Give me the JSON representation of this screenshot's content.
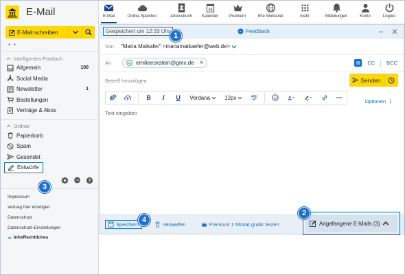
{
  "brand": {
    "logo_text": "WEB.DE",
    "app_title": "E-Mail"
  },
  "sidebar": {
    "compose_label": "E-Mail schreiben",
    "more_dots": "• •",
    "smart_inbox_heading": "Intelligentes Postfach",
    "smart_items": [
      {
        "label": "Allgemein",
        "count": "100",
        "icon": "inbox-icon"
      },
      {
        "label": "Social Media",
        "count": "",
        "icon": "social-icon"
      },
      {
        "label": "Newsletter",
        "count": "1",
        "icon": "newsletter-icon"
      },
      {
        "label": "Bestellungen",
        "count": "",
        "icon": "cart-icon"
      },
      {
        "label": "Verträge & Abos",
        "count": "",
        "icon": "contract-icon"
      }
    ],
    "folders_heading": "Ordner",
    "folders": [
      {
        "label": "Papierkorb",
        "icon": "trash-icon"
      },
      {
        "label": "Spam",
        "icon": "spam-icon"
      },
      {
        "label": "Gesendet",
        "icon": "sent-icon"
      },
      {
        "label": "Entwürfe",
        "icon": "pencil-icon"
      }
    ],
    "footer_links": [
      "Impressum",
      "Vertrag hier kündigen",
      "Datenschutz",
      "Datenschutz-Einstellungen"
    ],
    "footer_info": "Info/Rechtliches"
  },
  "topnav": [
    {
      "label": "E-Mail",
      "icon": "mail-icon",
      "active": true
    },
    {
      "label": "Online-Speicher",
      "icon": "cloud-icon",
      "active": false
    },
    {
      "label": "Adressbuch",
      "icon": "addressbook-icon",
      "active": false
    },
    {
      "label": "Kalender",
      "icon": "calendar-icon",
      "active": false,
      "day": "16"
    },
    {
      "label": "Premium",
      "icon": "crown-icon",
      "active": false
    },
    {
      "label": "Ihre Webseite",
      "icon": "globe-icon",
      "active": false
    },
    {
      "label": "mehr",
      "icon": "grid-icon",
      "active": false
    },
    {
      "label": "Mitteilungen",
      "icon": "bell-icon",
      "active": false
    },
    {
      "label": "Konto",
      "icon": "user-icon",
      "active": false
    },
    {
      "label": "Logout",
      "icon": "power-icon",
      "active": false
    }
  ],
  "compose": {
    "saved_status": "Gespeichert um 12:33 Uhr",
    "feedback_label": "Feedback",
    "from_label": "Von",
    "from_value": "\"Maria Maikafer\" <mariamaikaefer@web.de>",
    "to_label": "An",
    "recipient": "emilieeckstein@gmx.de",
    "cc_label": "CC",
    "bcc_label": "BCC",
    "subject_placeholder": "Betreff hinzufügen",
    "send_label": "Senden",
    "font_family": "Verdana",
    "font_size": "12px",
    "options_label": "Optionen",
    "body_placeholder": "Text eingeben"
  },
  "bottombar": {
    "save_label": "Speichern",
    "discard_label": "Verwerfen",
    "premium_label": "Premium 1 Monat gratis testen",
    "drafts_label": "Angefangene E-Mails (3)"
  },
  "badges": [
    "1",
    "2",
    "3",
    "4"
  ],
  "colors": {
    "accent": "#1a6fd6",
    "brand_yellow": "#ffd800",
    "navy": "#1c449b"
  }
}
